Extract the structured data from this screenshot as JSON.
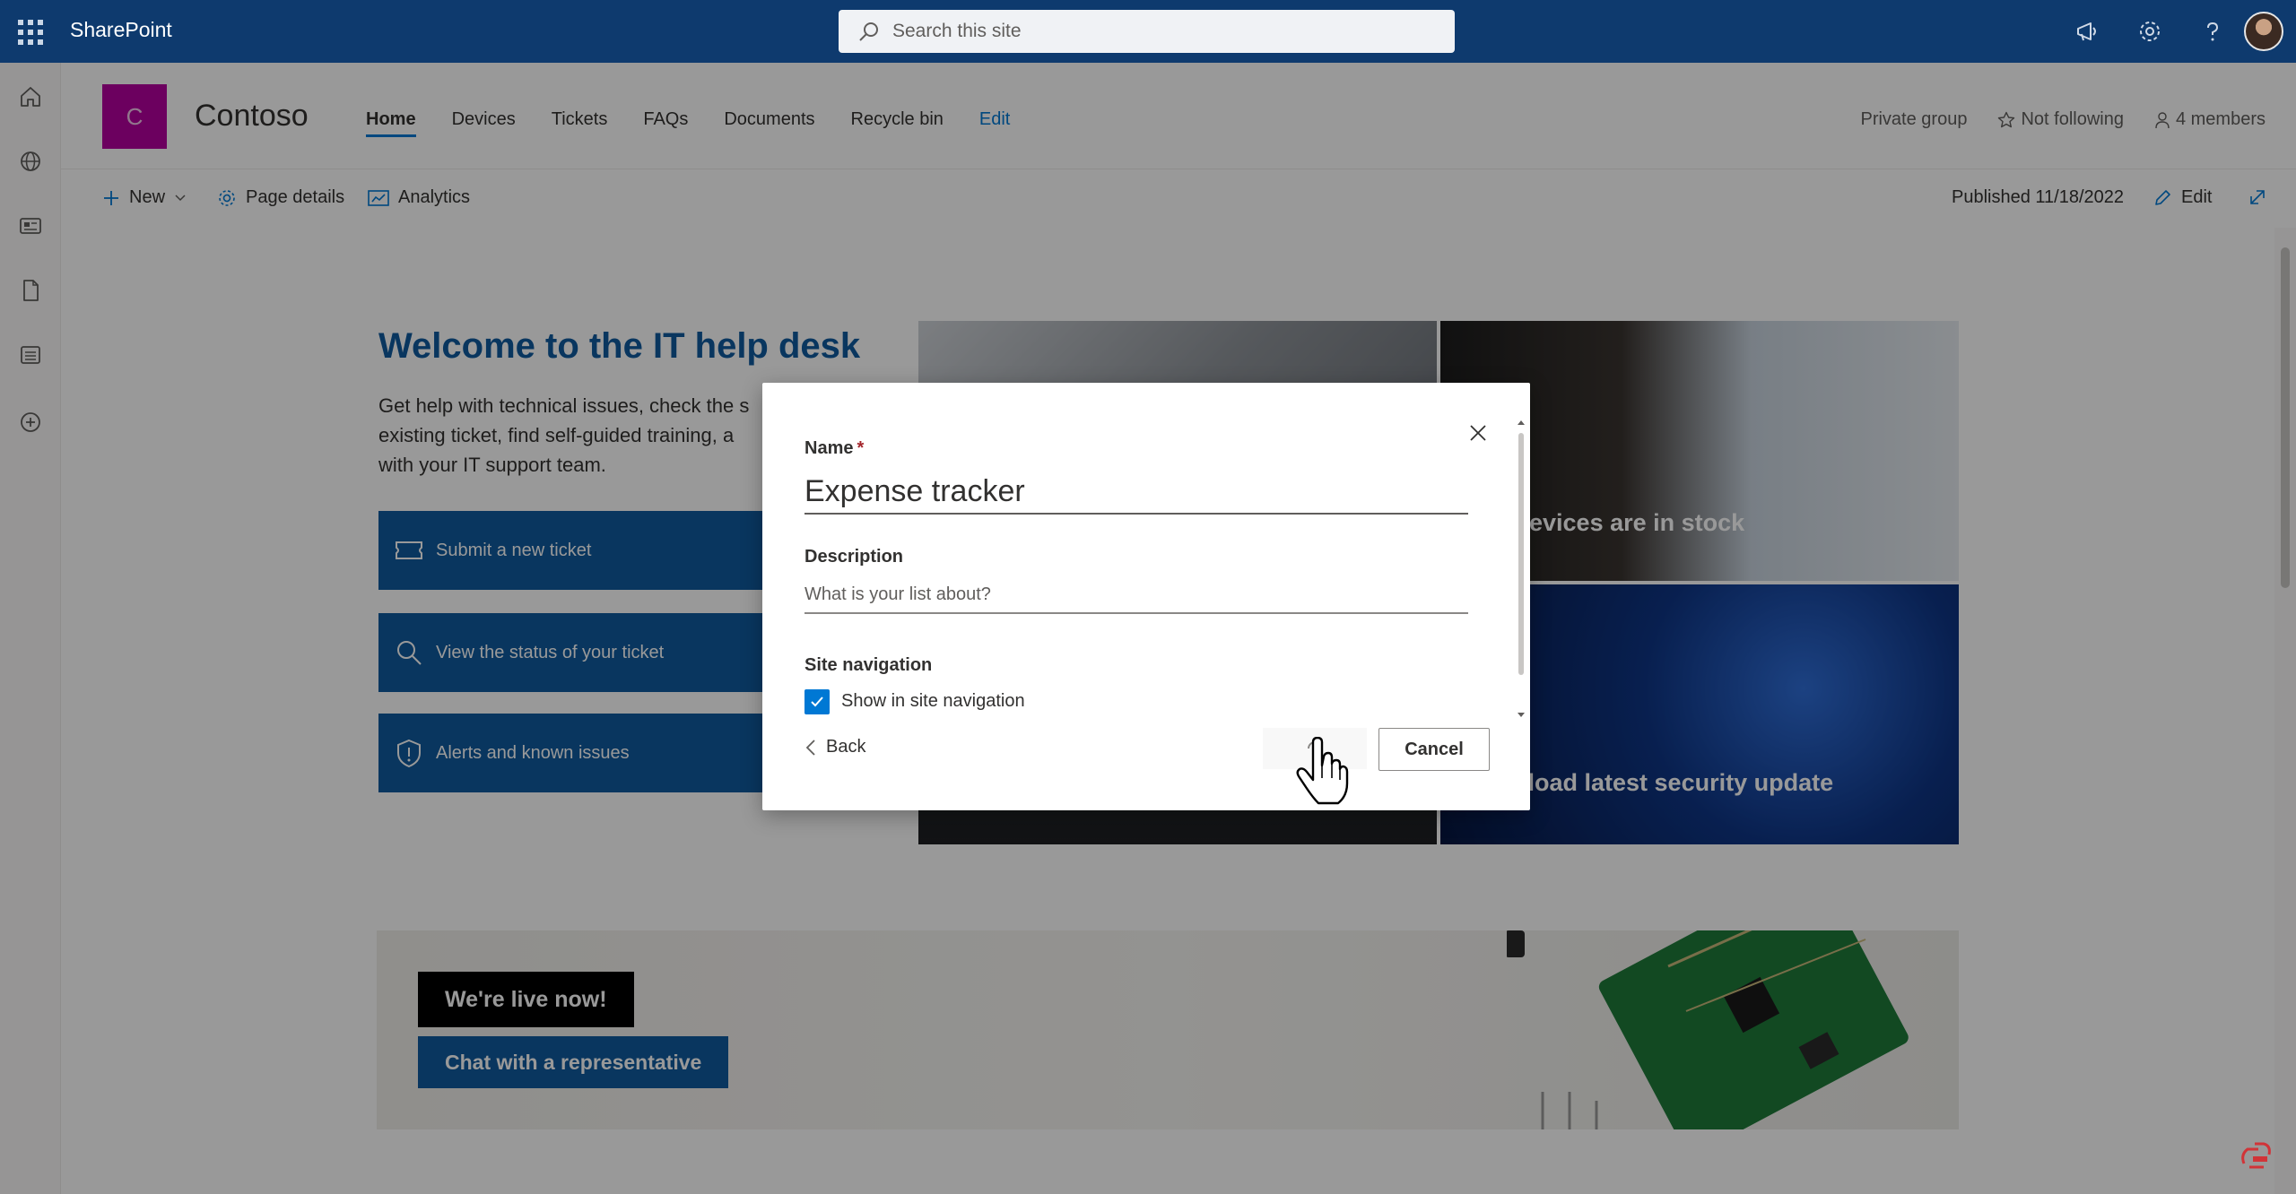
{
  "suite_bar": {
    "app_name": "SharePoint",
    "search_placeholder": "Search this site",
    "color": "#0e3a6e",
    "icons": [
      "waffle-icon",
      "megaphone-icon",
      "gear-icon",
      "help-icon",
      "avatar"
    ]
  },
  "left_rail": {
    "icons": [
      "home-icon",
      "globe-icon",
      "news-icon",
      "document-icon",
      "list-icon",
      "add-icon"
    ]
  },
  "site": {
    "logo_letter": "C",
    "logo_color": "#b4009e",
    "title": "Contoso",
    "nav": [
      {
        "label": "Home",
        "active": true
      },
      {
        "label": "Devices"
      },
      {
        "label": "Tickets"
      },
      {
        "label": "FAQs"
      },
      {
        "label": "Documents"
      },
      {
        "label": "Recycle bin"
      },
      {
        "label": "Edit"
      }
    ],
    "privacy": "Private group",
    "follow": "Not following",
    "members": "4 members"
  },
  "command_bar": {
    "new": "New",
    "page_details": "Page details",
    "analytics": "Analytics",
    "published": "Published 11/18/2022",
    "edit": "Edit"
  },
  "page": {
    "welcome_title": "Welcome to the IT help desk",
    "welcome_body": "Get help with technical issues, check the s existing ticket, find self-guided training, a with your IT support team.",
    "actions": [
      {
        "label": "Submit a new ticket",
        "icon": "ticket-icon"
      },
      {
        "label": "View the status of your ticket",
        "icon": "search-icon"
      },
      {
        "label": "Alerts and known issues",
        "icon": "shield-icon"
      }
    ],
    "hero_tiles": [
      {
        "caption": ""
      },
      {
        "caption": "y devices are in stock"
      },
      {
        "caption": "wnload latest security update"
      },
      {
        "caption": ""
      }
    ],
    "banner": {
      "live": "We're live now!",
      "chat": "Chat with a representative"
    },
    "accent": "#0f5a9e"
  },
  "dialog": {
    "name_label": "Name",
    "required_marker": "*",
    "name_value": "Expense tracker",
    "description_label": "Description",
    "description_placeholder": "What is your list about?",
    "site_nav_label": "Site navigation",
    "show_in_nav_label": "Show in site navigation",
    "show_in_nav_checked": true,
    "back_label": "Back",
    "cancel_label": "Cancel"
  }
}
